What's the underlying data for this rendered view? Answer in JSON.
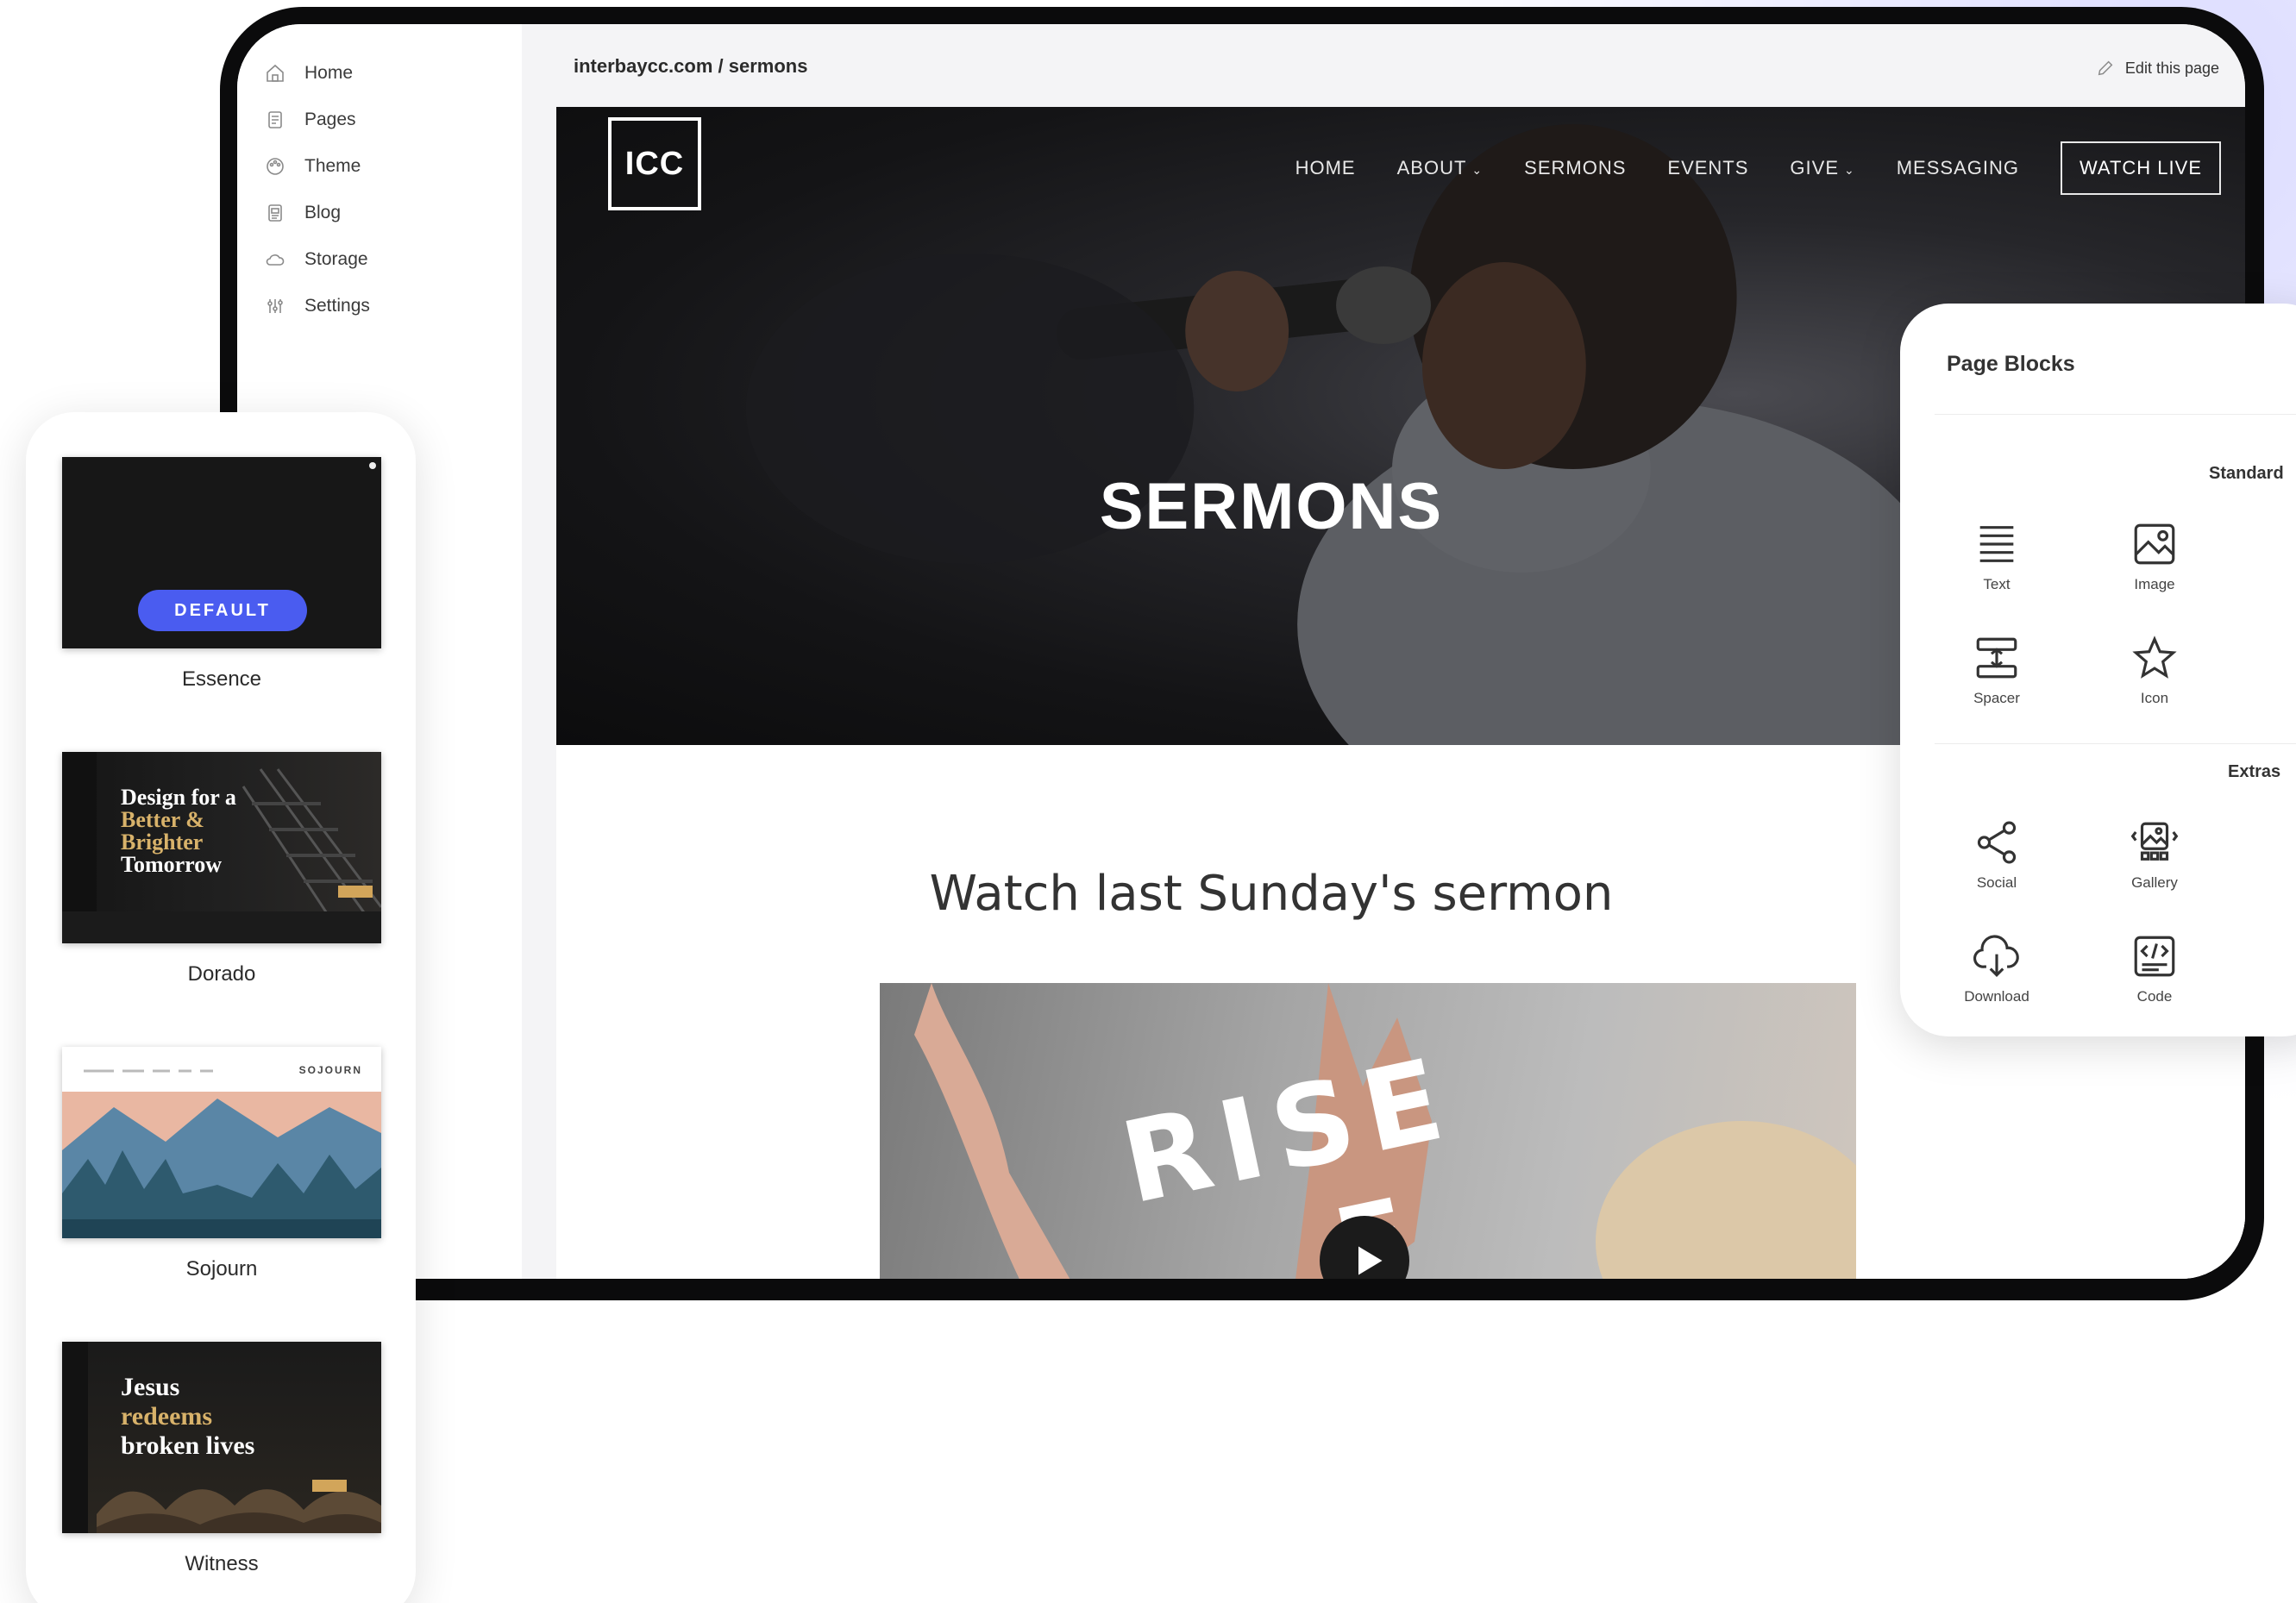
{
  "side_nav": {
    "items": [
      {
        "label": "Home",
        "icon": "home-icon"
      },
      {
        "label": "Pages",
        "icon": "pages-icon"
      },
      {
        "label": "Theme",
        "icon": "theme-icon"
      },
      {
        "label": "Blog",
        "icon": "blog-icon"
      },
      {
        "label": "Storage",
        "icon": "cloud-icon"
      },
      {
        "label": "Settings",
        "icon": "settings-icon"
      }
    ]
  },
  "topbar": {
    "url": "interbaycc.com / sermons",
    "edit_label": "Edit this page"
  },
  "site": {
    "logo": "ICC",
    "nav": {
      "home": "HOME",
      "about": "ABOUT",
      "sermons": "SERMONS",
      "events": "EVENTS",
      "give": "GIVE",
      "messaging": "MESSAGING",
      "watch_live": "WATCH LIVE"
    },
    "hero_title": "SERMONS",
    "section_title": "Watch last Sunday's sermon",
    "video_cover_line1": "RISE",
    "video_cover_line2": "E"
  },
  "themes": {
    "default_badge": "DEFAULT",
    "items": [
      {
        "name": "Essence"
      },
      {
        "name": "Dorado",
        "headline_1": "Design for a",
        "headline_2": "Better &",
        "headline_3": "Brighter",
        "headline_4": "Tomorrow"
      },
      {
        "name": "Sojourn",
        "brand": "SOJOURN"
      },
      {
        "name": "Witness",
        "headline_1": "Jesus",
        "headline_2": "redeems",
        "headline_3": "broken lives"
      }
    ]
  },
  "page_blocks": {
    "title": "Page Blocks",
    "standard_label": "Standard",
    "extras_label": "Extras",
    "standard": [
      {
        "label": "Text",
        "icon": "text-icon"
      },
      {
        "label": "Image",
        "icon": "image-icon"
      },
      {
        "label": "Spacer",
        "icon": "spacer-icon"
      },
      {
        "label": "Icon",
        "icon": "star-icon"
      }
    ],
    "extras": [
      {
        "label": "Social",
        "icon": "share-icon"
      },
      {
        "label": "Gallery",
        "icon": "gallery-icon"
      },
      {
        "label": "Download",
        "icon": "download-icon"
      },
      {
        "label": "Code",
        "icon": "code-icon"
      }
    ]
  },
  "colors": {
    "accent": "#4a5cf0",
    "device_frame": "#0b0b0c",
    "gold": "#d8b26a"
  }
}
